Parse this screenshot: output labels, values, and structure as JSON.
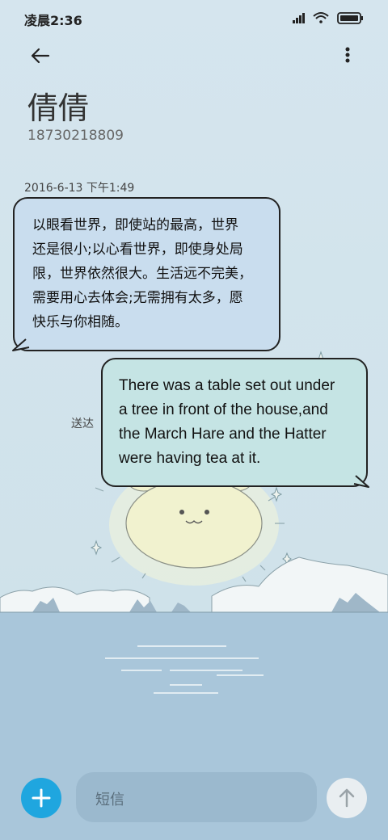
{
  "status_bar": {
    "time": "凌晨2:36"
  },
  "header": {
    "contact_name": "倩倩",
    "contact_number": "18730218809"
  },
  "conversation": {
    "timestamp": "2016-6-13 下午1:49",
    "messages": [
      {
        "direction": "incoming",
        "lines": [
          "以眼看世界，即使站的最高，世界",
          "还是很小;以心看世界，即使身处局",
          "限，世界依然很大。生活远不完美，",
          "需要用心去体会;无需拥有太多，愿",
          "快乐与你相随。"
        ]
      },
      {
        "direction": "outgoing",
        "lines": [
          "There was a table set out under",
          "a tree in front of the house,and",
          "the March Hare and the Hatter",
          "were having tea at it."
        ],
        "status": "送达"
      }
    ]
  },
  "composer": {
    "placeholder": "短信"
  },
  "icons": {
    "back": "back-arrow-icon",
    "more": "more-vertical-icon",
    "add": "plus-icon",
    "send": "send-arrow-up-icon",
    "signal": "signal-icon",
    "wifi": "wifi-icon",
    "battery": "battery-icon"
  },
  "colors": {
    "accent": "#1fa6df",
    "incoming_bubble": "#c9ddee",
    "outgoing_bubble": "#c5e4e4"
  }
}
